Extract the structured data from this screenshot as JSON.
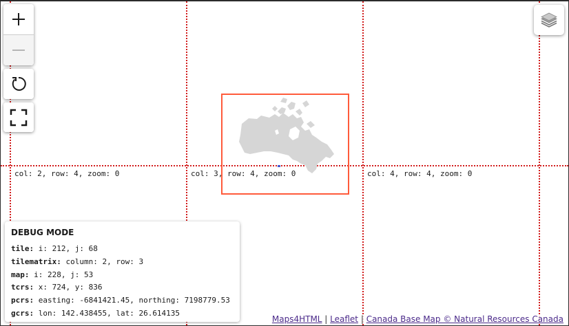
{
  "controls": {
    "zoom_in_label": "+",
    "zoom_out_label": "—",
    "zoom_out_disabled": true,
    "icons": [
      "zoom-in-icon",
      "zoom-out-icon",
      "reload-icon",
      "fullscreen-icon",
      "layers-icon"
    ]
  },
  "tiles": [
    {
      "label": "col: 2, row: 4, zoom: 0"
    },
    {
      "label": "col: 3, row: 4, zoom: 0"
    },
    {
      "label": "col: 4, row: 4, zoom: 0"
    }
  ],
  "debug": {
    "title": "DEBUG MODE",
    "rows": [
      {
        "key": "tile:",
        "value": "i: 212, j: 68"
      },
      {
        "key": "tilematrix:",
        "value": "column: 2, row: 3"
      },
      {
        "key": "map:",
        "value": "i: 228, j: 53"
      },
      {
        "key": "tcrs:",
        "value": "x: 724, y: 836"
      },
      {
        "key": "pcrs:",
        "value": "easting: -6841421.45, northing: 7198779.53"
      },
      {
        "key": "gcrs:",
        "value": "lon: 142.438455, lat: 26.614135"
      }
    ]
  },
  "attribution": {
    "link1": "Maps4HTML",
    "sep1": " | ",
    "link2": "Leaflet",
    "sep2": " | ",
    "link3": "Canada Base Map © Natural Resources Canada"
  },
  "colors": {
    "grid_line": "#d11a1a",
    "extent_box": "#ff5a3a",
    "land": "#d6d6d6",
    "link": "#4b2a8a"
  }
}
